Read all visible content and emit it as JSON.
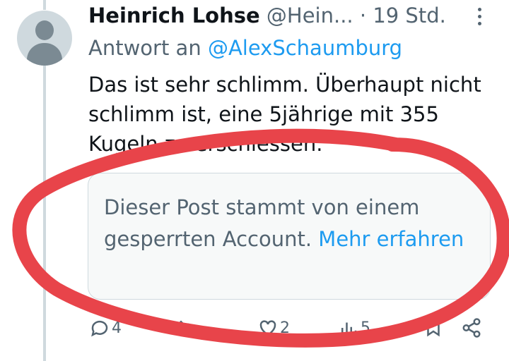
{
  "tweet": {
    "author_name": "Heinrich Lohse",
    "author_handle": "@Hein...",
    "separator": "·",
    "time": "19 Std.",
    "reply_prefix": "Antwort an",
    "reply_to": "@AlexSchaumburg",
    "text": "Das ist sehr schlimm. Überhaupt nicht schlimm ist, eine 5jährige mit 355 Kugeln zu erschiessen."
  },
  "notice": {
    "text": "Dieser Post stammt von einem gesperrten Account.",
    "link": "Mehr erfahren"
  },
  "actions": {
    "reply_count": "4",
    "retweet_count": "",
    "like_count": "2",
    "views_count": "5"
  },
  "icons": {
    "more": "more-vertical-icon",
    "reply": "reply-icon",
    "retweet": "retweet-icon",
    "like": "heart-icon",
    "views": "views-icon",
    "bookmark": "bookmark-icon",
    "share": "share-icon"
  },
  "colors": {
    "link": "#1d9bf0",
    "muted": "#536471",
    "annotation": "#e8444a"
  }
}
